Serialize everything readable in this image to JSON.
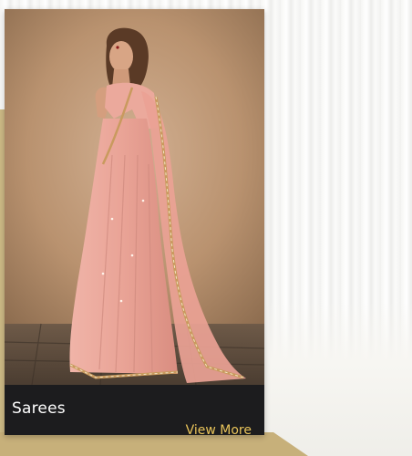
{
  "card": {
    "category_title": "Sarees",
    "link_label": "View More",
    "image_subject": "woman-in-peach-saree-photo"
  },
  "colors": {
    "card_footer": "#1c1c1e",
    "link": "#e8c35a",
    "title_text": "#ffffff",
    "saree_peach": "#e9a79c",
    "wall_tan": "#b99473",
    "accent_gold": "#c7b07a"
  }
}
